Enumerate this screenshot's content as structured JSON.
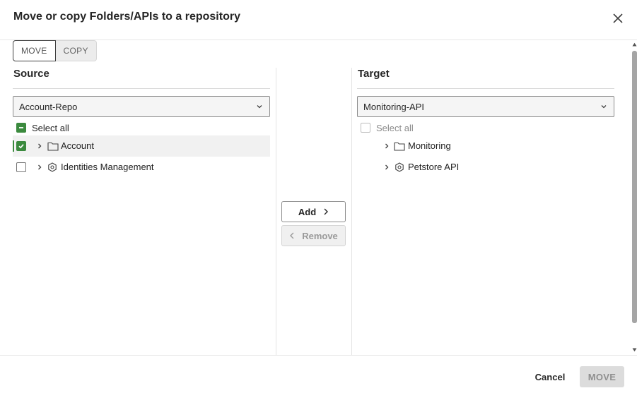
{
  "dialog": {
    "title": "Move or copy Folders/APIs to a repository"
  },
  "mode_tabs": [
    {
      "label": "MOVE",
      "selected": true
    },
    {
      "label": "COPY",
      "selected": false
    }
  ],
  "source": {
    "heading": "Source",
    "repository": "Account-Repo",
    "select_all_label": "Select all",
    "select_all_state": "indeterminate",
    "items": [
      {
        "label": "Account",
        "kind": "folder-icon",
        "checked": true
      },
      {
        "label": "Identities Management",
        "kind": "api-icon",
        "checked": false
      }
    ]
  },
  "actions": {
    "add_label": "Add",
    "remove_label": "Remove"
  },
  "target": {
    "heading": "Target",
    "repository": "Monitoring-API",
    "select_all_label": "Select all",
    "items": [
      {
        "label": "Monitoring",
        "kind": "folder-icon"
      },
      {
        "label": "Petstore API",
        "kind": "api-icon"
      }
    ]
  },
  "footer": {
    "cancel_label": "Cancel",
    "confirm_label": "MOVE"
  },
  "colors": {
    "checkbox_green": "#3b8a3e",
    "disabled_button": "#dcdcdc"
  }
}
